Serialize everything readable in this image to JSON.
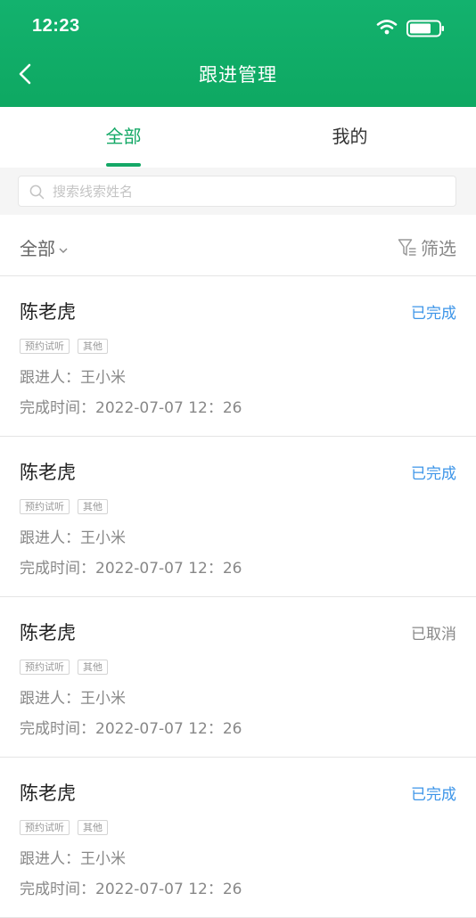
{
  "status_bar": {
    "time": "12:23"
  },
  "nav": {
    "title": "跟进管理"
  },
  "tabs": [
    {
      "label": "全部",
      "active": true
    },
    {
      "label": "我的",
      "active": false
    }
  ],
  "search": {
    "placeholder": "搜索线索姓名",
    "value": ""
  },
  "filter_bar": {
    "scope_label": "全部",
    "filter_label": "筛选"
  },
  "colors": {
    "brand": "#13b26e",
    "completed": "#3d95e8",
    "cancelled": "#888888"
  },
  "records": [
    {
      "name": "陈老虎",
      "status": "已完成",
      "status_type": "completed",
      "tags": [
        "预约试听",
        "其他"
      ],
      "follower": "跟进人：王小米",
      "time": "完成时间：2022-07-07  12：26"
    },
    {
      "name": "陈老虎",
      "status": "已完成",
      "status_type": "completed",
      "tags": [
        "预约试听",
        "其他"
      ],
      "follower": "跟进人：王小米",
      "time": "完成时间：2022-07-07  12：26"
    },
    {
      "name": "陈老虎",
      "status": "已取消",
      "status_type": "cancelled",
      "tags": [
        "预约试听",
        "其他"
      ],
      "follower": "跟进人：王小米",
      "time": "完成时间：2022-07-07  12：26"
    },
    {
      "name": "陈老虎",
      "status": "已完成",
      "status_type": "completed",
      "tags": [
        "预约试听",
        "其他"
      ],
      "follower": "跟进人：王小米",
      "time": "完成时间：2022-07-07  12：26"
    }
  ]
}
